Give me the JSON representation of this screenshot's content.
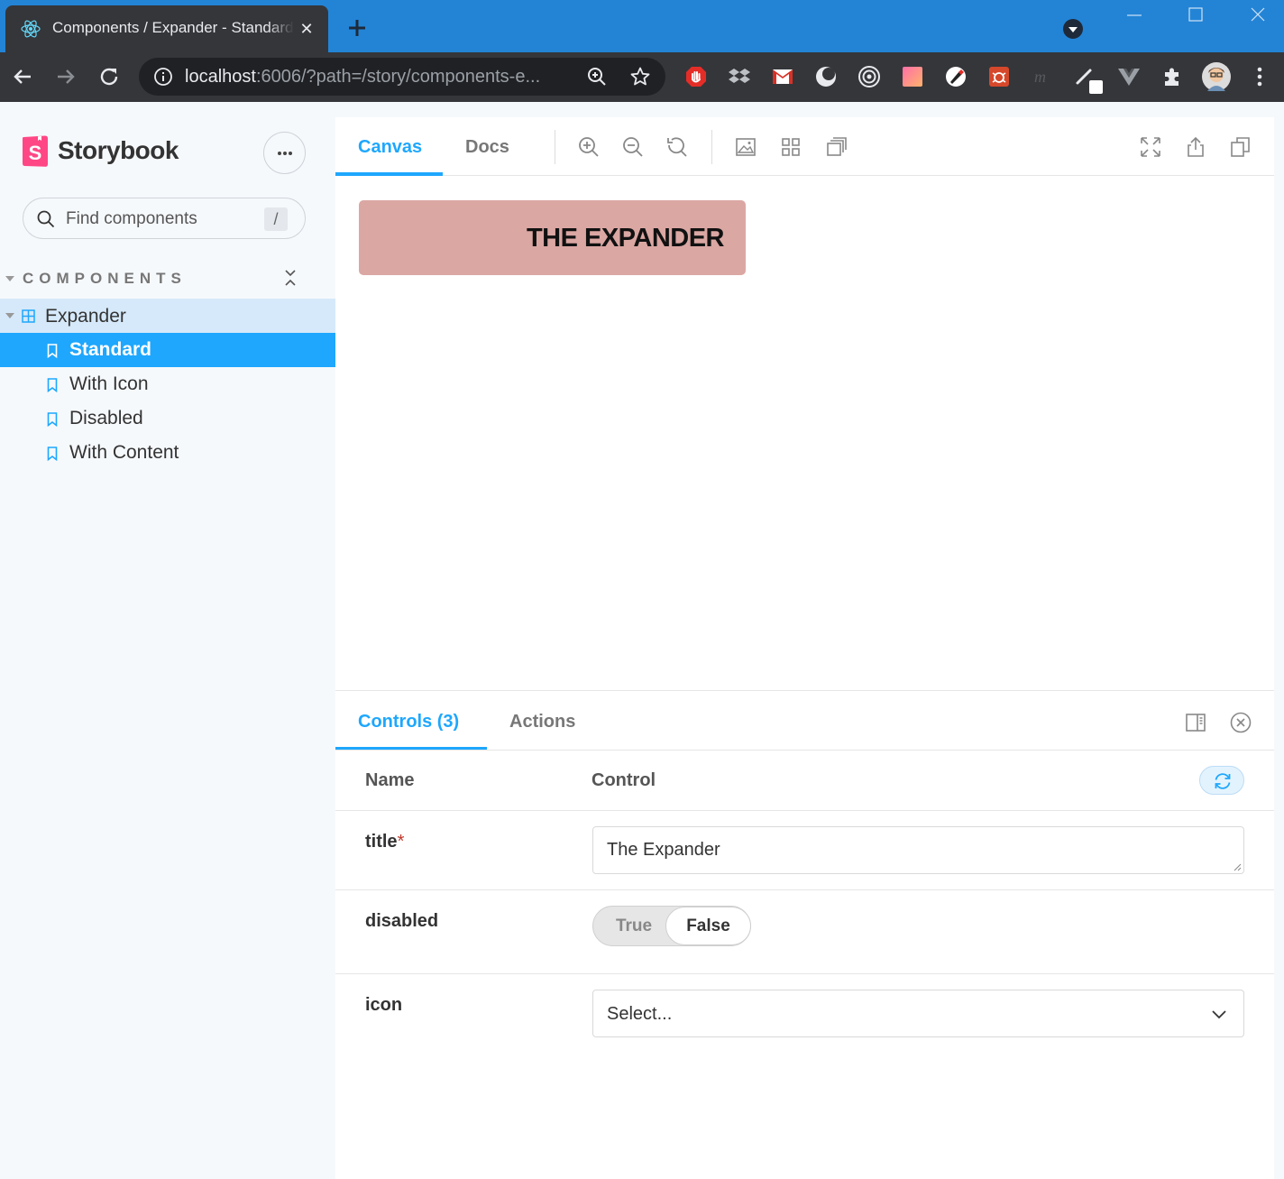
{
  "browser": {
    "tab_title": "Components / Expander - Standard",
    "tab_close": "✕",
    "url_host": "localhost",
    "url_rest": ":6006/?path=/story/components-e..."
  },
  "sidebar": {
    "brand": "Storybook",
    "search_placeholder": "Find components",
    "search_shortcut": "/",
    "section_label": "COMPONENTS",
    "group_label": "Expander",
    "items": [
      {
        "label": "Standard",
        "selected": true
      },
      {
        "label": "With Icon",
        "selected": false
      },
      {
        "label": "Disabled",
        "selected": false
      },
      {
        "label": "With Content",
        "selected": false
      }
    ]
  },
  "preview": {
    "tabs": {
      "canvas": "Canvas",
      "docs": "Docs"
    },
    "expander_title": "The Expander"
  },
  "addons": {
    "tabs": {
      "controls": "Controls (3)",
      "actions": "Actions"
    },
    "headers": {
      "name": "Name",
      "control": "Control"
    },
    "rows": {
      "title": {
        "name": "title",
        "required_mark": "*",
        "value": "The Expander"
      },
      "disabled": {
        "name": "disabled",
        "true_label": "True",
        "false_label": "False",
        "value": false
      },
      "icon": {
        "name": "icon",
        "placeholder": "Select..."
      }
    }
  },
  "colors": {
    "accent": "#1ea7fd",
    "browser_frame": "#2384d6",
    "expander_bg": "#dba7a3",
    "storybook_pink": "#ff4785"
  }
}
